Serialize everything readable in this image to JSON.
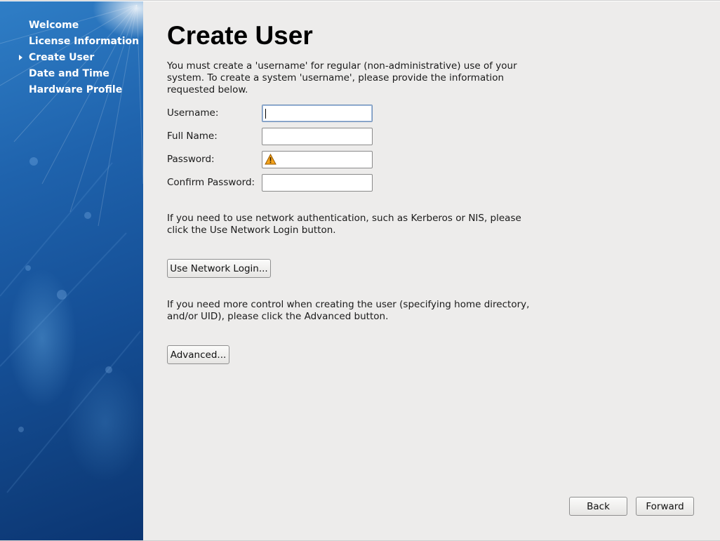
{
  "sidebar": {
    "items": [
      {
        "label": "Welcome"
      },
      {
        "label": "License Information"
      },
      {
        "label": "Create User"
      },
      {
        "label": "Date and Time"
      },
      {
        "label": "Hardware Profile"
      }
    ],
    "current_index": 2
  },
  "page": {
    "title": "Create User",
    "intro": "You must create a 'username' for regular (non-administrative) use of your system.  To create a system 'username', please provide the information requested below.",
    "network_text": "If you need to use network authentication, such as Kerberos or NIS, please click the Use Network Login button.",
    "advanced_text": "If you need more control when creating the user (specifying home directory, and/or UID), please click the Advanced button."
  },
  "form": {
    "username": {
      "label": "Username:",
      "value": ""
    },
    "full_name": {
      "label": "Full Name:",
      "value": ""
    },
    "password": {
      "label": "Password:",
      "value": "",
      "status_icon": "warning-icon"
    },
    "confirm_password": {
      "label": "Confirm Password:",
      "value": ""
    }
  },
  "buttons": {
    "network_login": "Use Network Login...",
    "advanced": "Advanced...",
    "back": "Back",
    "forward": "Forward"
  },
  "colors": {
    "sidebar_blue": "#1f63ad",
    "content_bg": "#edeceb",
    "warning": "#f0a020"
  }
}
